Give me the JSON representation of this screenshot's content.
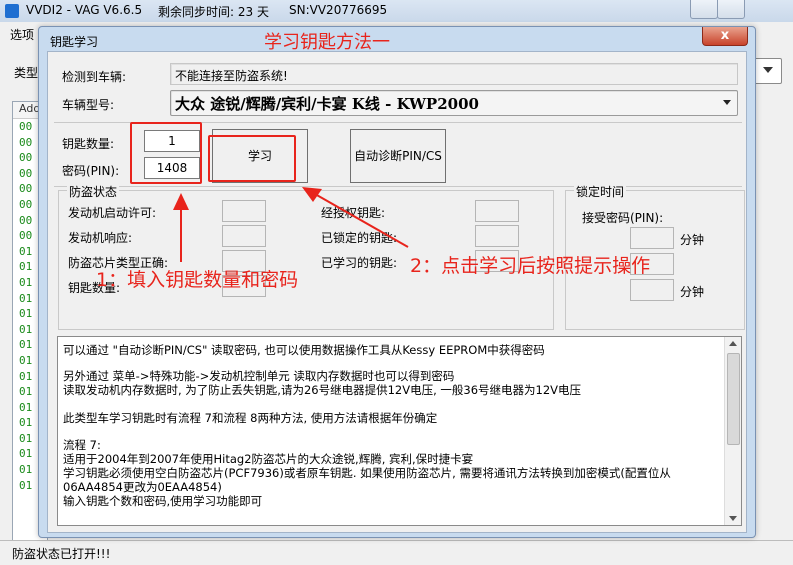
{
  "main_window": {
    "title": "VVDI2 - VAG V6.6.5",
    "sync_time": "剩余同步时间: 23 天",
    "serial": "SN:VV20776695",
    "menu_first": "选项",
    "type_label": "类型",
    "list_header": "Add",
    "list_rows": [
      "00",
      "00",
      "00",
      "00",
      "00",
      "00",
      "00",
      "00",
      "01",
      "01",
      "01",
      "01",
      "01",
      "01",
      "01",
      "01",
      "01",
      "01",
      "01",
      "01",
      "01",
      "01",
      "01",
      "01"
    ],
    "status": "防盗状态已打开!!!"
  },
  "dialog": {
    "title": "钥匙学习",
    "close_label": "x",
    "detected_label": "检测到车辆:",
    "detected_value": "不能连接至防盗系统!",
    "model_label": "车辆型号:",
    "model_value": "大众 途锐/辉腾/宾利/卡宴 K线 - KWP2000",
    "key_count_label": "钥匙数量:",
    "key_count_value": "1",
    "pin_label": "密码(PIN):",
    "pin_value": "1408",
    "learn_button": "学习",
    "auto_pin_button": "自动诊断PIN/CS",
    "immo_group": {
      "caption": "防盗状态",
      "engine_start": "发动机启动许可:",
      "engine_response": "发动机响应:",
      "chip_type": "防盗芯片类型正确:",
      "key_count": "钥匙数量:",
      "authorized_keys": "经授权钥匙:",
      "locked_keys": "已锁定的钥匙:",
      "learned_keys": "已学习的钥匙:"
    },
    "lock_group": {
      "caption": "锁定时间",
      "accept_pin": "接受密码(PIN):",
      "minutes_1": "分钟",
      "minutes_2": "分钟"
    },
    "memo_lines": [
      "可以通过 \"自动诊断PIN/CS\" 读取密码, 也可以使用数据操作工具从Kessy EEPROM中获得密码",
      "",
      "另外通过 菜单->特殊功能->发动机控制单元 读取内存数据时也可以得到密码",
      "读取发动机内存数据时, 为了防止丢失钥匙,请为26号继电器提供12V电压, 一般36号继电器为12V电压",
      "",
      "此类型车学习钥匙时有流程 7和流程 8两种方法, 使用方法请根据年份确定",
      "",
      "流程 7:",
      "适用于2004年到2007年使用Hitag2防盗芯片的大众途锐,辉腾, 宾利,保时捷卡宴",
      "学习钥匙必须使用空白防盗芯片(PCF7936)或者原车钥匙. 如果使用防盗芯片, 需要将通讯方法转换到加密模式(配置位从",
      "06AA4854更改为0EAA4854)",
      "输入钥匙个数和密码,使用学习功能即可"
    ]
  },
  "annotations": {
    "title_note": "学习钥匙方法一",
    "note_1": "1：填入钥匙数量和密码",
    "note_2": "2：点击学习后按照提示操作",
    "color": "#e8241c"
  }
}
